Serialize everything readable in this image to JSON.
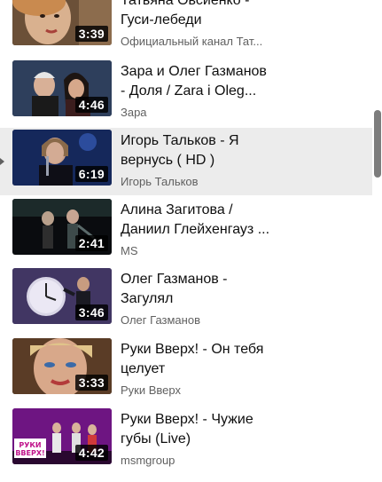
{
  "playlist": {
    "items": [
      {
        "title_lines": [
          "Татьяна Овсиенко -",
          "Гуси-лебеди"
        ],
        "channel": "Официальный канал Тат...",
        "duration": "3:39",
        "thumb": "woman-face",
        "active": false
      },
      {
        "title_lines": [
          "Зара и Олег Газманов",
          "- Доля / Zara i Oleg..."
        ],
        "channel": "Зара",
        "duration": "4:46",
        "thumb": "duet-couple",
        "active": false
      },
      {
        "title_lines": [
          "Игорь Тальков - Я",
          "вернусь ( HD )"
        ],
        "channel": "Игорь Тальков",
        "duration": "6:19",
        "thumb": "singer-stage",
        "active": true
      },
      {
        "title_lines": [
          "Алина Загитова /",
          "Даниил Глейхенгауз ..."
        ],
        "channel": "MS",
        "duration": "2:41",
        "thumb": "skaters-dark",
        "active": false
      },
      {
        "title_lines": [
          "Олег Газманов -",
          "Загулял"
        ],
        "channel": "Олег Газманов",
        "duration": "3:46",
        "thumb": "clock-scene",
        "active": false
      },
      {
        "title_lines": [
          "Руки Вверх! - Он тебя",
          "целует"
        ],
        "channel": "Руки Вверх",
        "duration": "3:33",
        "thumb": "woman-closeup",
        "active": false
      },
      {
        "title_lines": [
          "Руки Вверх! - Чужие",
          "губы (Live)"
        ],
        "channel": "msmgroup",
        "duration": "4:42",
        "thumb": "band-stage",
        "active": false
      }
    ]
  },
  "thumb_texts": {
    "band_logo_line1": "РУКИ",
    "band_logo_line2": "ВВЕРХ!"
  },
  "colors": {
    "title": "#0f0f0f",
    "channel": "#606060",
    "active_bg": "#ececec",
    "duration_bg": "#000000"
  },
  "icons": {
    "now_playing": "play-marker-icon"
  }
}
